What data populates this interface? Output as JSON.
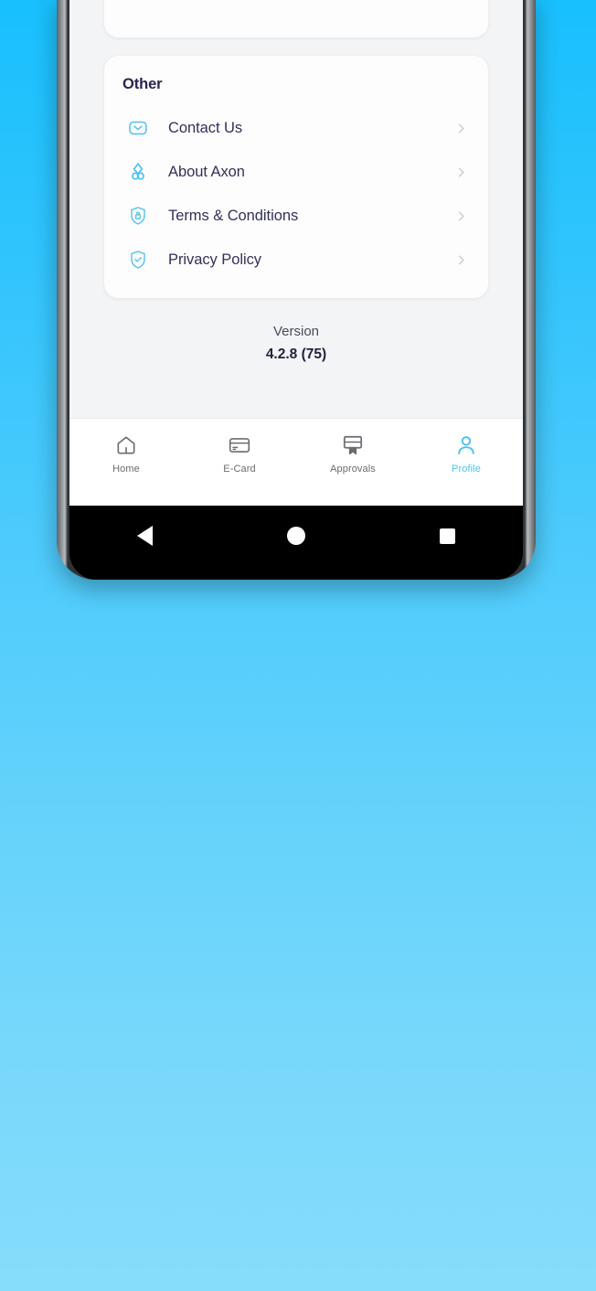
{
  "device": {
    "platform": "android",
    "system_nav": [
      {
        "name": "back",
        "glyph": "triangle-left"
      },
      {
        "name": "home",
        "glyph": "circle"
      },
      {
        "name": "recents",
        "glyph": "square"
      }
    ]
  },
  "theme": {
    "background_gradient_top": "#18c0fd",
    "background_gradient_bottom": "#86dcfb",
    "accent": "#4ec2f0",
    "card_background": "#fdfdfe",
    "screen_background": "#f3f4f6",
    "heading_color": "#2a2450",
    "body_text_color": "#33305a",
    "chevron_color": "#c9c9d1",
    "tab_inactive_color": "#6b6b72"
  },
  "screen": {
    "cut_off_card": {
      "visible": true,
      "note": "partially scrolled-off settings card above"
    },
    "other_card": {
      "title": "Other",
      "items": [
        {
          "label": "Contact Us",
          "icon": "envelope-icon",
          "chevron": "chevron-right-icon"
        },
        {
          "label": "About Axon",
          "icon": "axon-logo-icon",
          "chevron": "chevron-right-icon"
        },
        {
          "label": "Terms & Conditions",
          "icon": "shield-lock-icon",
          "chevron": "chevron-right-icon"
        },
        {
          "label": "Privacy Policy",
          "icon": "shield-check-icon",
          "chevron": "chevron-right-icon"
        }
      ]
    },
    "version": {
      "label": "Version",
      "value": "4.2.8 (75)"
    },
    "tab_bar": {
      "items": [
        {
          "label": "Home",
          "icon": "home-icon",
          "active": false
        },
        {
          "label": "E-Card",
          "icon": "card-icon",
          "active": false
        },
        {
          "label": "Approvals",
          "icon": "approvals-icon",
          "active": false
        },
        {
          "label": "Profile",
          "icon": "person-icon",
          "active": true
        }
      ]
    }
  }
}
